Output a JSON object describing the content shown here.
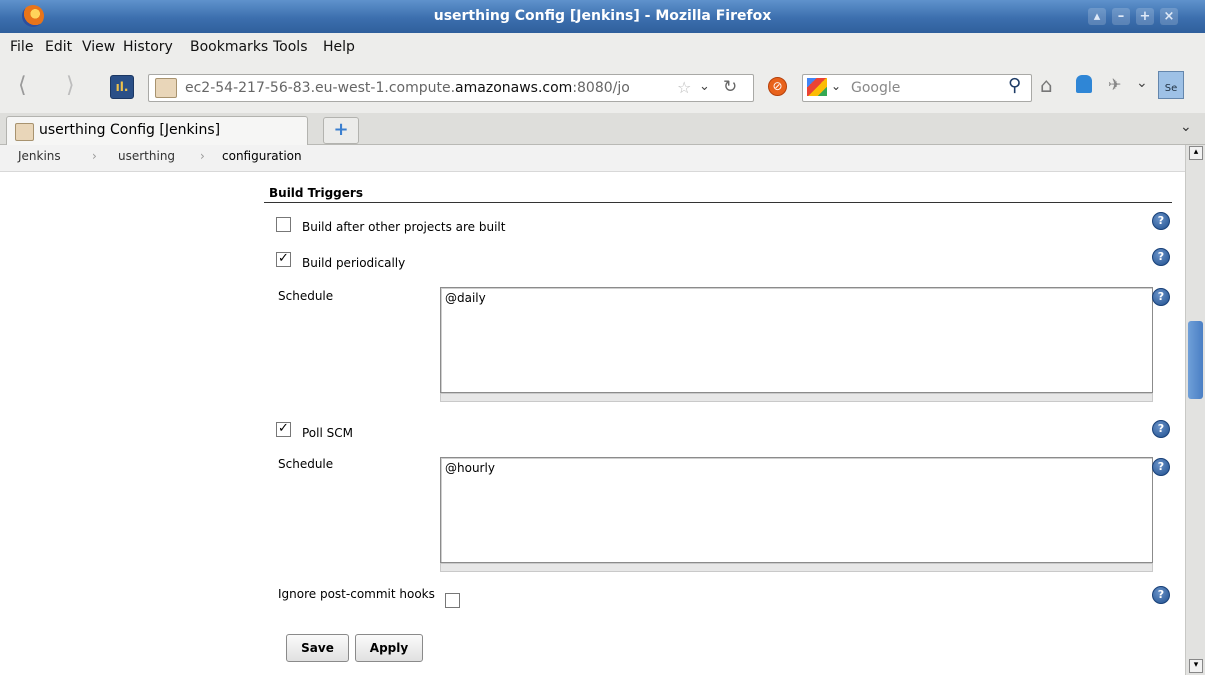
{
  "window": {
    "title": "userthing Config [Jenkins] - Mozilla Firefox"
  },
  "menu": [
    "File",
    "Edit",
    "View",
    "History",
    "Bookmarks",
    "Tools",
    "Help"
  ],
  "toolbar": {
    "url_prefix": "ec2-54-217-56-83.eu-west-1.compute.",
    "url_domain": "amazonaws.com",
    "url_suffix": ":8080/jo",
    "search_placeholder": "Google"
  },
  "tab": {
    "label": "userthing Config [Jenkins]"
  },
  "breadcrumb": [
    "Jenkins",
    "userthing",
    "configuration"
  ],
  "form": {
    "section_title": "Build Triggers",
    "build_after": {
      "label": "Build after other projects are built",
      "checked": false
    },
    "build_periodically": {
      "label": "Build periodically",
      "checked": true,
      "schedule_label": "Schedule",
      "schedule_value": "@daily"
    },
    "poll_scm": {
      "label": "Poll SCM",
      "checked": true,
      "schedule_label": "Schedule",
      "schedule_value": "@hourly"
    },
    "ignore_hooks": {
      "label": "Ignore post-commit hooks",
      "checked": false
    },
    "save_label": "Save",
    "apply_label": "Apply"
  }
}
